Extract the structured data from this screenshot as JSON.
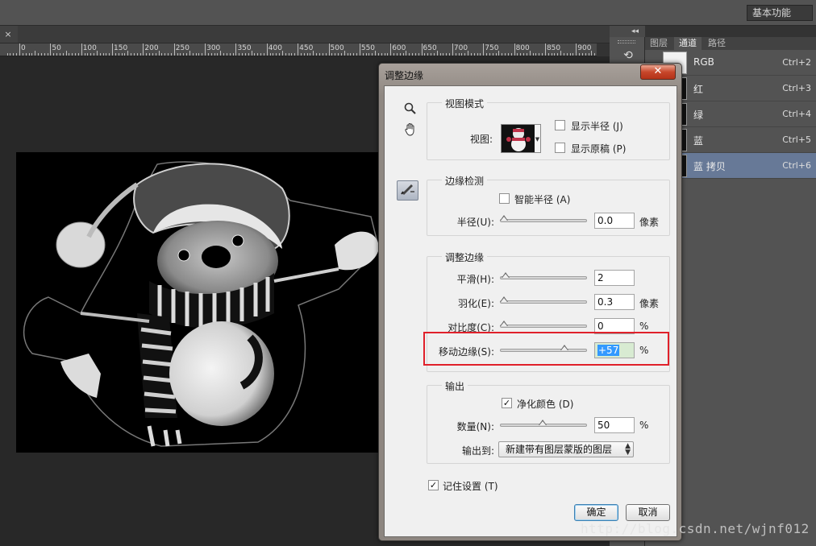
{
  "app": {
    "workspace": "基本功能",
    "close_glyph": "×",
    "panel_collapse_glyph": "◂◂"
  },
  "ruler": {
    "labels": [
      "0",
      "50",
      "100",
      "150",
      "200",
      "250",
      "300",
      "350",
      "400",
      "450",
      "500",
      "550",
      "600",
      "650",
      "700",
      "750",
      "800",
      "850",
      "900"
    ]
  },
  "panels": {
    "tabs": [
      "图层",
      "通道",
      "路径"
    ],
    "active_tab": "通道",
    "channels": [
      {
        "name": "RGB",
        "shortcut": "Ctrl+2",
        "selected": false
      },
      {
        "name": "红",
        "shortcut": "Ctrl+3",
        "selected": false
      },
      {
        "name": "绿",
        "shortcut": "Ctrl+4",
        "selected": false
      },
      {
        "name": "蓝",
        "shortcut": "Ctrl+5",
        "selected": false
      },
      {
        "name": "蓝 拷贝",
        "shortcut": "Ctrl+6",
        "selected": true
      }
    ]
  },
  "dialog": {
    "title": "调整边缘",
    "close_label": "✕",
    "view_mode": {
      "legend": "视图模式",
      "view_label": "视图:",
      "show_radius": {
        "label": "显示半径",
        "key": "(J)",
        "checked": false
      },
      "show_original": {
        "label": "显示原稿",
        "key": "(P)",
        "checked": false
      }
    },
    "edge_detection": {
      "legend": "边缘检测",
      "smart_radius": {
        "label": "智能半径",
        "key": "(A)",
        "checked": false
      },
      "radius": {
        "label": "半径(U):",
        "value": "0.0",
        "unit": "像素",
        "slider": 0.0
      }
    },
    "adjust_edge": {
      "legend": "调整边缘",
      "smooth": {
        "label": "平滑(H):",
        "value": "2",
        "unit": "",
        "slider": 0.02
      },
      "feather": {
        "label": "羽化(E):",
        "value": "0.3",
        "unit": "像素",
        "slider": 0.003
      },
      "contrast": {
        "label": "对比度(C):",
        "value": "0",
        "unit": "%",
        "slider": 0.0
      },
      "shift_edge": {
        "label": "移动边缘(S):",
        "value": "+57",
        "unit": "%",
        "slider": 0.785
      }
    },
    "output": {
      "legend": "输出",
      "decontaminate": {
        "label": "净化颜色",
        "key": "(D)",
        "checked": true
      },
      "amount": {
        "label": "数量(N):",
        "value": "50",
        "unit": "%",
        "slider": 0.5
      },
      "output_to_label": "输出到:",
      "output_to_value": "新建带有图层蒙版的图层"
    },
    "remember": {
      "label": "记住设置",
      "key": "(T)",
      "checked": true
    },
    "ok_label": "确定",
    "cancel_label": "取消"
  },
  "watermark": "http://blog.csdn.net/wjnf012",
  "colors": {
    "highlight": "#e0202a",
    "selected_channel": "#677997",
    "text_selection": "#3399ff"
  }
}
